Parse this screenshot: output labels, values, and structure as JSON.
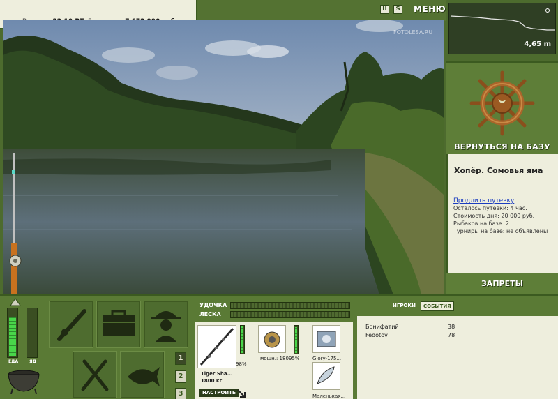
{
  "header": {
    "time_label": "Время:",
    "time_value": "22:10 ВТ",
    "money_label": "Деньги:",
    "money_value": "7 672 990 руб.",
    "menu_label": "МЕНЮ",
    "pause_icon": "pause-icon",
    "sound_icon": "sound-icon",
    "watermark": "FOTOLESA.RU"
  },
  "minimap": {
    "depth": "4,65 m"
  },
  "base": {
    "return_label": "ВЕРНУТЬСЯ НА БАЗУ",
    "helm_icon": "ship-wheel-icon"
  },
  "location": {
    "title": "Хопёр. Сомовья яма",
    "extend_link": "Продлить путевку",
    "lines": [
      "Осталось путевки: 4 час.",
      "Стоимость дня: 20 000 руб.",
      "Рыбаков на базе: 2",
      "Турниры на базе: не объявлены"
    ]
  },
  "bans_label": "ЗАПРЕТЫ",
  "status": {
    "food_label": "ЕДА",
    "poison_label": "ЯД",
    "food_level": 0.85,
    "poison_level": 0.0
  },
  "pages": [
    "1",
    "2",
    "3"
  ],
  "tackle": {
    "rod_label": "УДОЧКА",
    "line_label": "ЛЕСКА",
    "rod_name": "Tiger Sha...",
    "rod_power": "1800 кг",
    "rod_percent": "98%",
    "reel_info": "мощн.: 180",
    "reel_percent": "95%",
    "line_name": "Glory-175...",
    "lure_name": "Маленькая...",
    "setup_label": "НАСТРОИТЬ"
  },
  "players": {
    "tabs": [
      "ИГРОКИ",
      "СОБЫТИЯ"
    ],
    "active_tab": 1,
    "rows": [
      {
        "name": "Бонифатий",
        "value": "38"
      },
      {
        "name": "Fedotov",
        "value": "78"
      }
    ]
  },
  "colors": {
    "panel_green": "#5a7a35",
    "dark_green": "#3b5a20",
    "cream": "#eeeedd",
    "meter_green": "#49d64a",
    "link_blue": "#1a3cc0"
  }
}
